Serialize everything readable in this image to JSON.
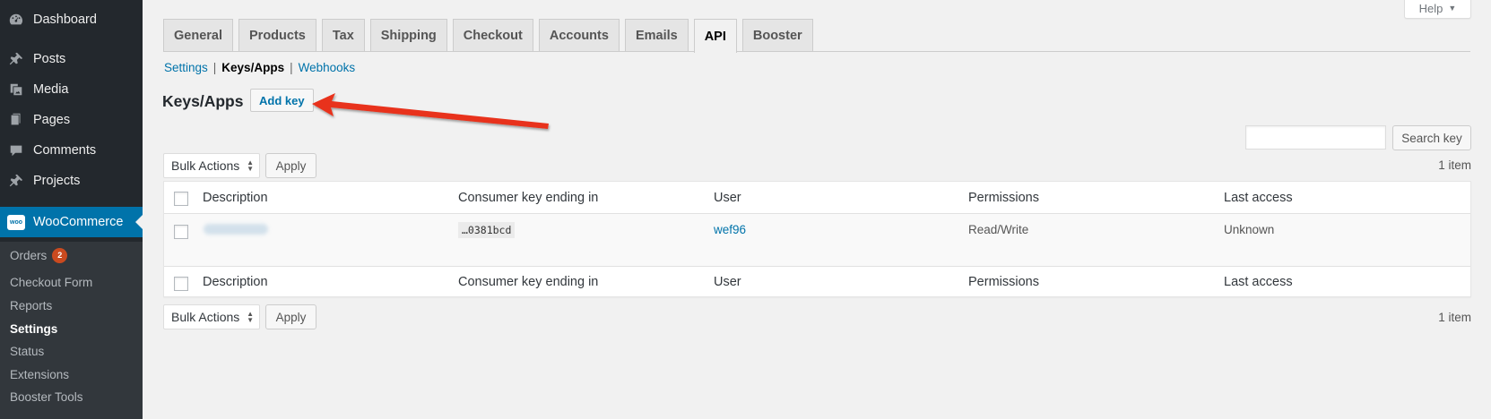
{
  "sidebar": {
    "items": [
      {
        "label": "Dashboard",
        "icon": "dashboard-icon"
      },
      {
        "label": "Posts",
        "icon": "pushpin-icon"
      },
      {
        "label": "Media",
        "icon": "media-icon"
      },
      {
        "label": "Pages",
        "icon": "pages-icon"
      },
      {
        "label": "Comments",
        "icon": "comments-icon"
      },
      {
        "label": "Projects",
        "icon": "pushpin-icon"
      },
      {
        "label": "WooCommerce",
        "icon": "woo-icon",
        "icon_text": "woo"
      }
    ],
    "submenu": [
      {
        "label": "Orders",
        "badge": "2"
      },
      {
        "label": "Checkout Form"
      },
      {
        "label": "Reports"
      },
      {
        "label": "Settings",
        "current": true
      },
      {
        "label": "Status"
      },
      {
        "label": "Extensions"
      },
      {
        "label": "Booster Tools"
      }
    ]
  },
  "help": {
    "label": "Help",
    "caret": "▼"
  },
  "tabs": [
    "General",
    "Products",
    "Tax",
    "Shipping",
    "Checkout",
    "Accounts",
    "Emails",
    "API",
    "Booster"
  ],
  "active_tab": "API",
  "subnav": {
    "settings": "Settings",
    "keys": "Keys/Apps",
    "webhooks": "Webhooks",
    "sep": "|"
  },
  "page": {
    "title": "Keys/Apps",
    "add_key": "Add key"
  },
  "search": {
    "button": "Search key",
    "value": ""
  },
  "bulk": {
    "label": "Bulk Actions",
    "apply": "Apply",
    "count": "1 item"
  },
  "table": {
    "columns": [
      "Description",
      "Consumer key ending in",
      "User",
      "Permissions",
      "Last access"
    ],
    "rows": [
      {
        "key": "…0381bcd",
        "user": "wef96",
        "permissions": "Read/Write",
        "last_access": "Unknown"
      }
    ]
  },
  "colors": {
    "accent": "#0073aa",
    "sidebar_bg": "#23282d",
    "annotation_arrow": "#e8311a",
    "badge": "#ca4a1f"
  }
}
